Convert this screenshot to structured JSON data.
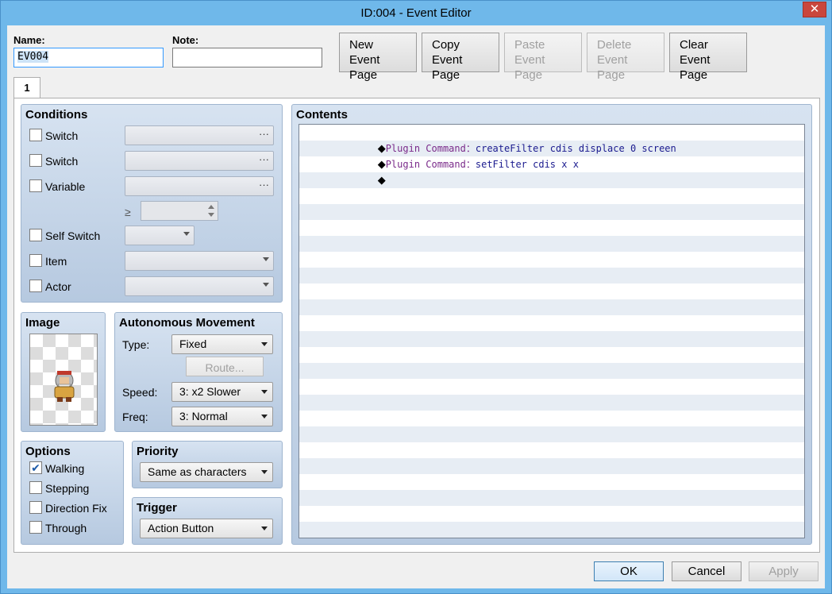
{
  "window": {
    "title": "ID:004 - Event Editor",
    "close_glyph": "✕"
  },
  "header": {
    "name_label": "Name:",
    "name_value": "EV004",
    "note_label": "Note:",
    "note_value": "",
    "buttons": [
      {
        "line1": "New",
        "line2": "Event Page",
        "enabled": true
      },
      {
        "line1": "Copy",
        "line2": "Event Page",
        "enabled": true
      },
      {
        "line1": "Paste",
        "line2": "Event Page",
        "enabled": false
      },
      {
        "line1": "Delete",
        "line2": "Event Page",
        "enabled": false
      },
      {
        "line1": "Clear",
        "line2": "Event Page",
        "enabled": true
      }
    ]
  },
  "tabs": [
    {
      "label": "1"
    }
  ],
  "conditions": {
    "title": "Conditions",
    "switch1_label": "Switch",
    "switch2_label": "Switch",
    "variable_label": "Variable",
    "compare_symbol": "≥",
    "self_switch_label": "Self Switch",
    "item_label": "Item",
    "actor_label": "Actor",
    "ellipsis": "···"
  },
  "image": {
    "title": "Image",
    "sprite": "armored-warrior-sprite"
  },
  "autonomous_movement": {
    "title": "Autonomous Movement",
    "type_label": "Type:",
    "type_value": "Fixed",
    "route_label": "Route...",
    "speed_label": "Speed:",
    "speed_value": "3: x2 Slower",
    "freq_label": "Freq:",
    "freq_value": "3: Normal"
  },
  "options": {
    "title": "Options",
    "walking_label": "Walking",
    "walking_checked": true,
    "stepping_label": "Stepping",
    "direction_fix_label": "Direction Fix",
    "through_label": "Through",
    "check_glyph": "✔"
  },
  "priority": {
    "title": "Priority",
    "value": "Same as characters"
  },
  "trigger": {
    "title": "Trigger",
    "value": "Action Button"
  },
  "contents": {
    "title": "Contents",
    "lines": [
      {
        "marker": "◆",
        "command": "Plugin Command",
        "sep": "：",
        "args": "createFilter cdis displace 0 screen"
      },
      {
        "marker": "◆",
        "command": "Plugin Command",
        "sep": "：",
        "args": "setFilter cdis x x"
      },
      {
        "marker": "◆",
        "command": "",
        "sep": "",
        "args": ""
      }
    ]
  },
  "footer": {
    "ok_label": "OK",
    "cancel_label": "Cancel",
    "apply_label": "Apply"
  },
  "colors": {
    "title_bar": "#6fb8ea",
    "group_top": "#d7e3f1",
    "group_bottom": "#b6c9e0",
    "command_keyword": "#7a2a8a",
    "command_args": "#1b1b8f"
  }
}
